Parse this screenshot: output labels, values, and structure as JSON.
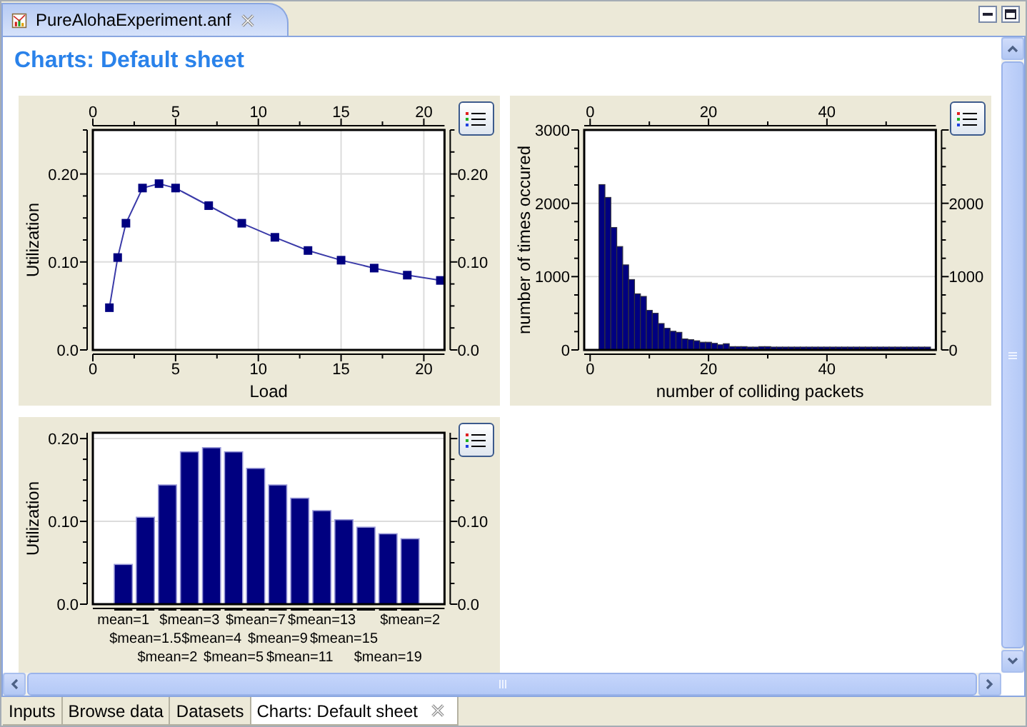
{
  "editor_tab": {
    "title": "PureAlohaExperiment.anf"
  },
  "page_title": "Charts: Default sheet",
  "charts": [
    {
      "chart_data": {
        "type": "line",
        "xlabel": "Load",
        "ylabel": "Utilization",
        "grid": true,
        "x": [
          1,
          1.5,
          2,
          3,
          4,
          5,
          7,
          9,
          11,
          13,
          15,
          17,
          19,
          21
        ],
        "xlim": [
          0,
          21.25
        ],
        "ylim": [
          0,
          0.25
        ],
        "x2lim": [
          0,
          21.25
        ],
        "y2lim": [
          0,
          0.25
        ],
        "xticks": [
          0,
          5,
          10,
          15,
          20
        ],
        "x2ticks": [
          0,
          5,
          10,
          15,
          20
        ],
        "yticks": [
          {
            "value": 0,
            "label": "0.0"
          },
          {
            "value": 0.1,
            "label": "0.10"
          },
          {
            "value": 0.2,
            "label": "0.20"
          }
        ],
        "y2ticks": [
          {
            "value": 0,
            "label": "0.0"
          },
          {
            "value": 0.1,
            "label": "0.10"
          },
          {
            "value": 0.2,
            "label": "0.20"
          }
        ],
        "series": [
          {
            "color": "#000080",
            "marker": "square",
            "values": [
              0.048,
              0.105,
              0.144,
              0.184,
              0.189,
              0.184,
              0.164,
              0.144,
              0.128,
              0.113,
              0.102,
              0.093,
              0.085,
              0.079
            ]
          }
        ]
      }
    },
    {
      "chart_data": {
        "type": "bar",
        "xlabel": "number of colliding packets",
        "ylabel": "number of times occured",
        "grid": true,
        "x": [
          2,
          3,
          4,
          5,
          6,
          7,
          8,
          9,
          10,
          11,
          12,
          13,
          14,
          15,
          16,
          17,
          18,
          19,
          20,
          21,
          22,
          23,
          24,
          25,
          26,
          27,
          28,
          29,
          30,
          31,
          32,
          33,
          34,
          35,
          36,
          37,
          38,
          39,
          40,
          41,
          42,
          43,
          44,
          45,
          46,
          47,
          48,
          49,
          50,
          51,
          52,
          53,
          54,
          55,
          56,
          57
        ],
        "xlim": [
          -1,
          58.4
        ],
        "ylim": [
          0,
          3000
        ],
        "x2lim": [
          -1,
          58.4
        ],
        "y2lim": [
          0,
          3000
        ],
        "xticks": [
          0,
          20,
          40
        ],
        "x2ticks": [
          0,
          20,
          40
        ],
        "yticks": [
          0,
          1000,
          2000,
          3000
        ],
        "y2ticks": [
          0,
          1000,
          2000
        ],
        "series": [
          {
            "color": "#000080",
            "values": [
              2255,
              2080,
              1670,
              1410,
              1160,
              960,
              765,
              730,
              540,
              500,
              360,
              295,
              255,
              240,
              150,
              140,
              125,
              105,
              105,
              90,
              70,
              85,
              45,
              45,
              45,
              30,
              30,
              45,
              45,
              12,
              12,
              12,
              12,
              12,
              12,
              12,
              12,
              12,
              12,
              12,
              12,
              12,
              12,
              12,
              12,
              12,
              12,
              12,
              12,
              12,
              12,
              12,
              12,
              12,
              12,
              12
            ]
          }
        ]
      }
    },
    {
      "chart_data": {
        "type": "bar",
        "ylabel": "Utilization",
        "grid": true,
        "categories": [
          "mean=1",
          "$mean=1.5",
          "$mean=2",
          "$mean=3",
          "$mean=4",
          "$mean=5",
          "$mean=7",
          "$mean=9",
          "$mean=11",
          "$mean=13",
          "$mean=15",
          null,
          "$mean=19",
          "$mean=2"
        ],
        "ylim": [
          0,
          0.207
        ],
        "y2lim": [
          0,
          0.207
        ],
        "yticks": [
          {
            "value": 0,
            "label": "0.0"
          },
          {
            "value": 0.1,
            "label": "0.10"
          },
          {
            "value": 0.2,
            "label": "0.20"
          }
        ],
        "y2ticks": [
          {
            "value": 0,
            "label": "0.0"
          },
          {
            "value": 0.1,
            "label": "0.10"
          }
        ],
        "series": [
          {
            "color": "#000080",
            "values": [
              0.048,
              0.105,
              0.144,
              0.184,
              0.189,
              0.184,
              0.164,
              0.144,
              0.128,
              0.113,
              0.102,
              0.093,
              0.085,
              0.079
            ]
          }
        ]
      }
    }
  ],
  "bottom_tabs": [
    {
      "label": "Inputs",
      "selected": false
    },
    {
      "label": "Browse data",
      "selected": false
    },
    {
      "label": "Datasets",
      "selected": false
    },
    {
      "label": "Charts: Default sheet",
      "selected": true
    }
  ]
}
